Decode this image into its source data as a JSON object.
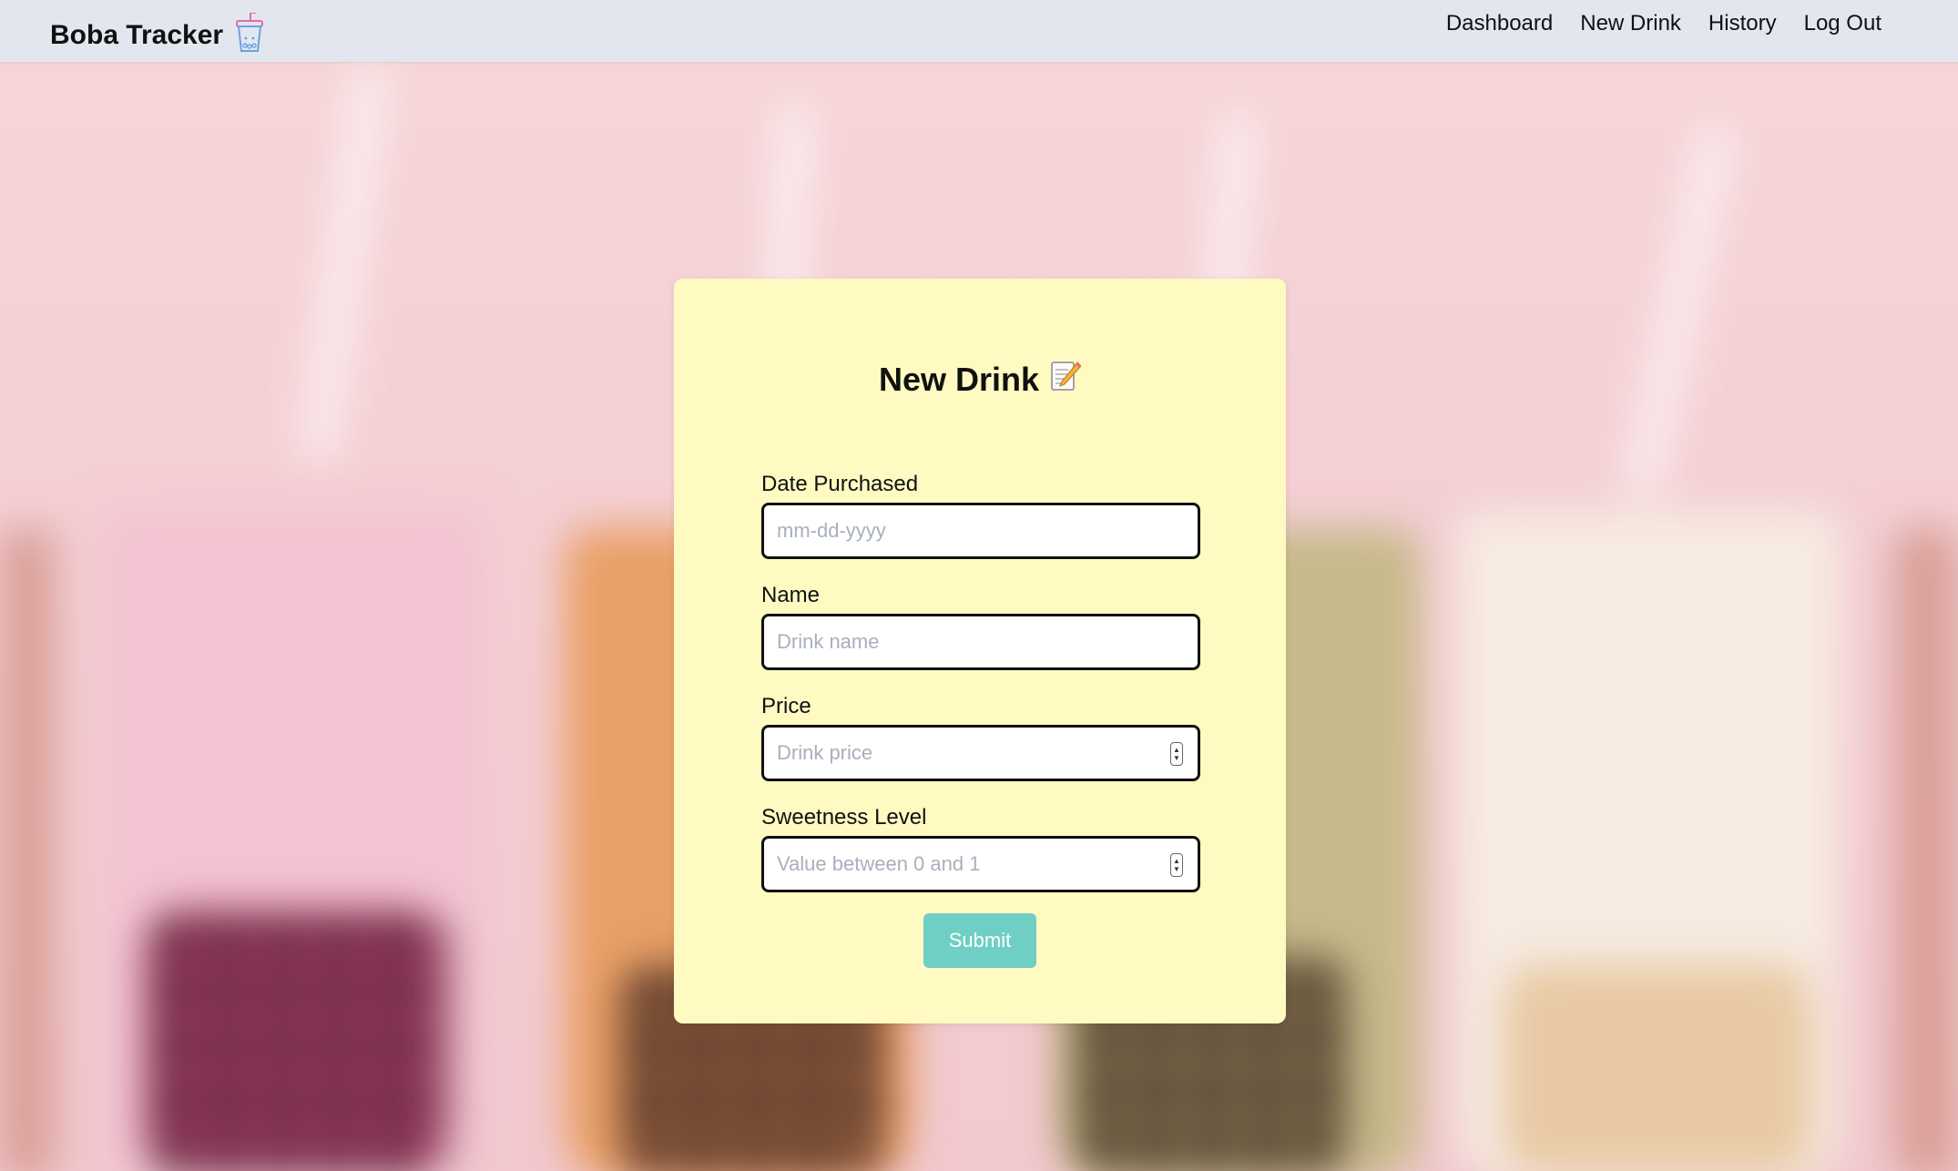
{
  "navbar": {
    "brand": "Boba Tracker",
    "brand_icon": "boba-cup-icon",
    "links": [
      "Dashboard",
      "New Drink",
      "History",
      "Log Out"
    ]
  },
  "form": {
    "title": "New Drink",
    "title_icon": "memo-pencil-icon",
    "fields": {
      "date": {
        "label": "Date Purchased",
        "placeholder": "mm-dd-yyyy"
      },
      "name": {
        "label": "Name",
        "placeholder": "Drink name"
      },
      "price": {
        "label": "Price",
        "placeholder": "Drink price"
      },
      "sweetness": {
        "label": "Sweetness Level",
        "placeholder": "Value between 0 and 1"
      }
    },
    "submit_label": "Submit"
  },
  "colors": {
    "navbar_bg": "#e2e7ef",
    "card_bg": "#fff9c2",
    "submit_bg": "#6fcfc4",
    "background": "#f4cfd4"
  }
}
